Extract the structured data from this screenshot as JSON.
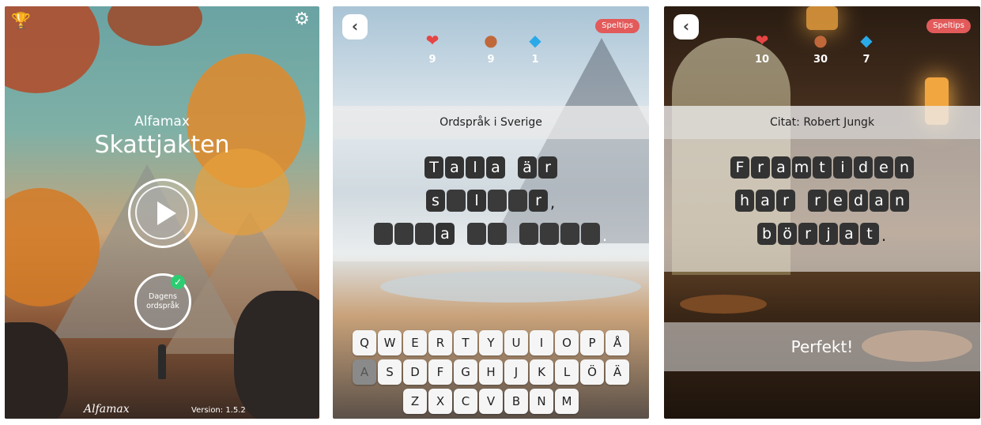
{
  "panel1": {
    "brand_small": "Alfamax",
    "title": "Skattjakten",
    "daily_button_label": "Dagens\nordspråk",
    "logo_text": "Alfamax",
    "version": "Version: 1.5.2",
    "icons": [
      "trophy-icon",
      "gear-icon",
      "play-icon",
      "check-icon"
    ]
  },
  "panel2": {
    "tips_label": "Speltips",
    "stats": {
      "hearts": "9",
      "coins": "9",
      "gems": "1"
    },
    "category": "Ordspråk i Sverige",
    "puzzle_rows": [
      [
        "T",
        "a",
        "l",
        "a",
        " ",
        "ä",
        "r"
      ],
      [
        "s",
        "",
        "l",
        "",
        "",
        "r",
        ","
      ],
      [
        "",
        "",
        "",
        "a",
        " ",
        "",
        "",
        " ",
        "",
        "",
        "",
        "",
        "."
      ]
    ],
    "keyboard": [
      [
        "Q",
        "W",
        "E",
        "R",
        "T",
        "Y",
        "U",
        "I",
        "O",
        "P",
        "Å"
      ],
      [
        "A",
        "S",
        "D",
        "F",
        "G",
        "H",
        "J",
        "K",
        "L",
        "Ö",
        "Ä"
      ],
      [
        "Z",
        "X",
        "C",
        "V",
        "B",
        "N",
        "M"
      ]
    ],
    "used_keys": [
      "A"
    ]
  },
  "panel3": {
    "tips_label": "Speltips",
    "stats": {
      "hearts": "10",
      "coins": "30",
      "gems": "7"
    },
    "category": "Citat: Robert Jungk",
    "puzzle_rows": [
      [
        "F",
        "r",
        "a",
        "m",
        "t",
        "i",
        "d",
        "e",
        "n"
      ],
      [
        "h",
        "a",
        "r",
        " ",
        "r",
        "e",
        "d",
        "a",
        "n"
      ],
      [
        "b",
        "ö",
        "r",
        "j",
        "a",
        "t",
        "."
      ]
    ],
    "result": "Perfekt!"
  }
}
